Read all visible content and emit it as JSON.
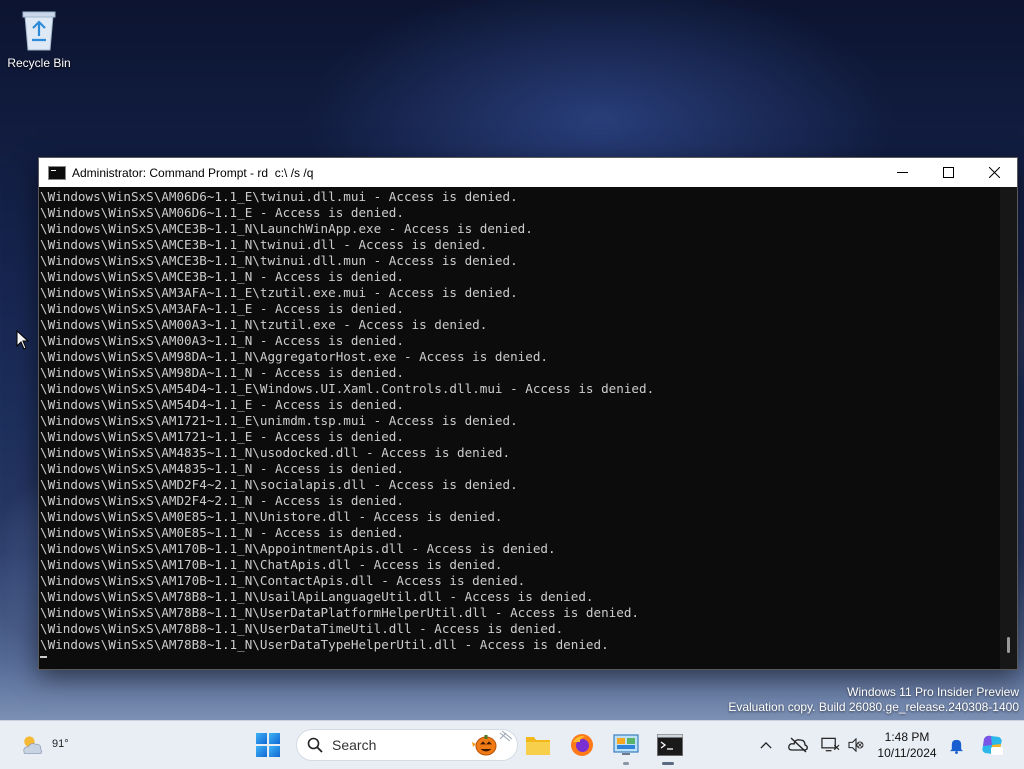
{
  "desktop": {
    "icons": [
      {
        "label": "Recycle Bin",
        "icon": "recycle-bin-icon"
      }
    ]
  },
  "cmd": {
    "title": "Administrator: Command Prompt - rd  c:\\ /s /q",
    "controls": {
      "minimize": "minimize-icon",
      "maximize": "maximize-icon",
      "close": "close-icon"
    },
    "lines": [
      "\\Windows\\WinSxS\\AM06D6~1.1_E\\twinui.dll.mui - Access is denied.",
      "\\Windows\\WinSxS\\AM06D6~1.1_E - Access is denied.",
      "\\Windows\\WinSxS\\AMCE3B~1.1_N\\LaunchWinApp.exe - Access is denied.",
      "\\Windows\\WinSxS\\AMCE3B~1.1_N\\twinui.dll - Access is denied.",
      "\\Windows\\WinSxS\\AMCE3B~1.1_N\\twinui.dll.mun - Access is denied.",
      "\\Windows\\WinSxS\\AMCE3B~1.1_N - Access is denied.",
      "\\Windows\\WinSxS\\AM3AFA~1.1_E\\tzutil.exe.mui - Access is denied.",
      "\\Windows\\WinSxS\\AM3AFA~1.1_E - Access is denied.",
      "\\Windows\\WinSxS\\AM00A3~1.1_N\\tzutil.exe - Access is denied.",
      "\\Windows\\WinSxS\\AM00A3~1.1_N - Access is denied.",
      "\\Windows\\WinSxS\\AM98DA~1.1_N\\AggregatorHost.exe - Access is denied.",
      "\\Windows\\WinSxS\\AM98DA~1.1_N - Access is denied.",
      "\\Windows\\WinSxS\\AM54D4~1.1_E\\Windows.UI.Xaml.Controls.dll.mui - Access is denied.",
      "\\Windows\\WinSxS\\AM54D4~1.1_E - Access is denied.",
      "\\Windows\\WinSxS\\AM1721~1.1_E\\unimdm.tsp.mui - Access is denied.",
      "\\Windows\\WinSxS\\AM1721~1.1_E - Access is denied.",
      "\\Windows\\WinSxS\\AM4835~1.1_N\\usodocked.dll - Access is denied.",
      "\\Windows\\WinSxS\\AM4835~1.1_N - Access is denied.",
      "\\Windows\\WinSxS\\AMD2F4~2.1_N\\socialapis.dll - Access is denied.",
      "\\Windows\\WinSxS\\AMD2F4~2.1_N - Access is denied.",
      "\\Windows\\WinSxS\\AM0E85~1.1_N\\Unistore.dll - Access is denied.",
      "\\Windows\\WinSxS\\AM0E85~1.1_N - Access is denied.",
      "\\Windows\\WinSxS\\AM170B~1.1_N\\AppointmentApis.dll - Access is denied.",
      "\\Windows\\WinSxS\\AM170B~1.1_N\\ChatApis.dll - Access is denied.",
      "\\Windows\\WinSxS\\AM170B~1.1_N\\ContactApis.dll - Access is denied.",
      "\\Windows\\WinSxS\\AM78B8~1.1_N\\UsailApiLanguageUtil.dll - Access is denied.",
      "\\Windows\\WinSxS\\AM78B8~1.1_N\\UserDataPlatformHelperUtil.dll - Access is denied.",
      "\\Windows\\WinSxS\\AM78B8~1.1_N\\UserDataTimeUtil.dll - Access is denied.",
      "\\Windows\\WinSxS\\AM78B8~1.1_N\\UserDataTypeHelperUtil.dll - Access is denied."
    ]
  },
  "watermark": {
    "line1": "Windows 11 Pro Insider Preview",
    "line2": "Evaluation copy. Build 26080.ge_release.240308-1400"
  },
  "taskbar": {
    "weather_temp": "91°",
    "search_placeholder": "Search",
    "apps": [
      "start-icon",
      "file-explorer-icon",
      "firefox-icon",
      "control-panel-icon",
      "command-prompt-icon"
    ],
    "clock_time": "1:48 PM",
    "clock_date": "10/11/2024",
    "tray": [
      "chevron-up-icon",
      "network-off-icon",
      "display-icon",
      "notification-bell-icon",
      "copilot-icon"
    ]
  },
  "colors": {
    "console_bg": "#0c0c0c",
    "console_text": "#cccccc",
    "taskbar_bg": "#e9eef5"
  }
}
